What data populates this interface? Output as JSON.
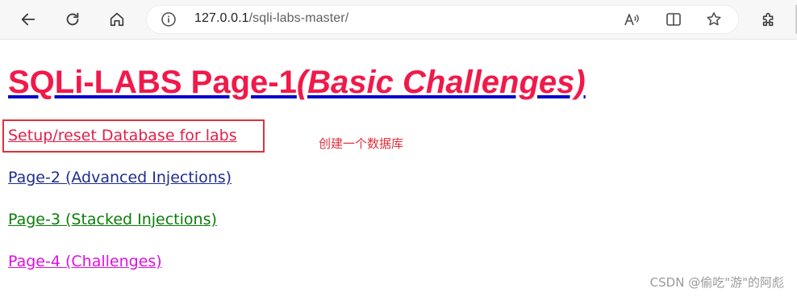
{
  "browser": {
    "url_host": "127.0.0.1",
    "url_path": "/sqli-labs-master/",
    "icons": [
      "back-icon",
      "refresh-icon",
      "home-icon",
      "site-info-icon",
      "read-aloud-icon",
      "split-screen-icon",
      "favorite-star-icon",
      "extensions-icon"
    ]
  },
  "page": {
    "title_main": "SQLi-LABS Page-1",
    "title_sub": "(Basic Challenges)",
    "links": [
      {
        "label": "Setup/reset Database for labs",
        "color": "#e0204a"
      },
      {
        "label": "Page-2 (Advanced Injections)",
        "color": "#1f2e8c"
      },
      {
        "label": "Page-3 (Stacked Injections)",
        "color": "#0a7d0a"
      },
      {
        "label": "Page-4 (Challenges)",
        "color": "#e010e0"
      }
    ],
    "annotation": "创建一个数据库",
    "annotation_color": "#e0303a",
    "watermark": "CSDN @偷吃\"游\"的阿彪"
  }
}
